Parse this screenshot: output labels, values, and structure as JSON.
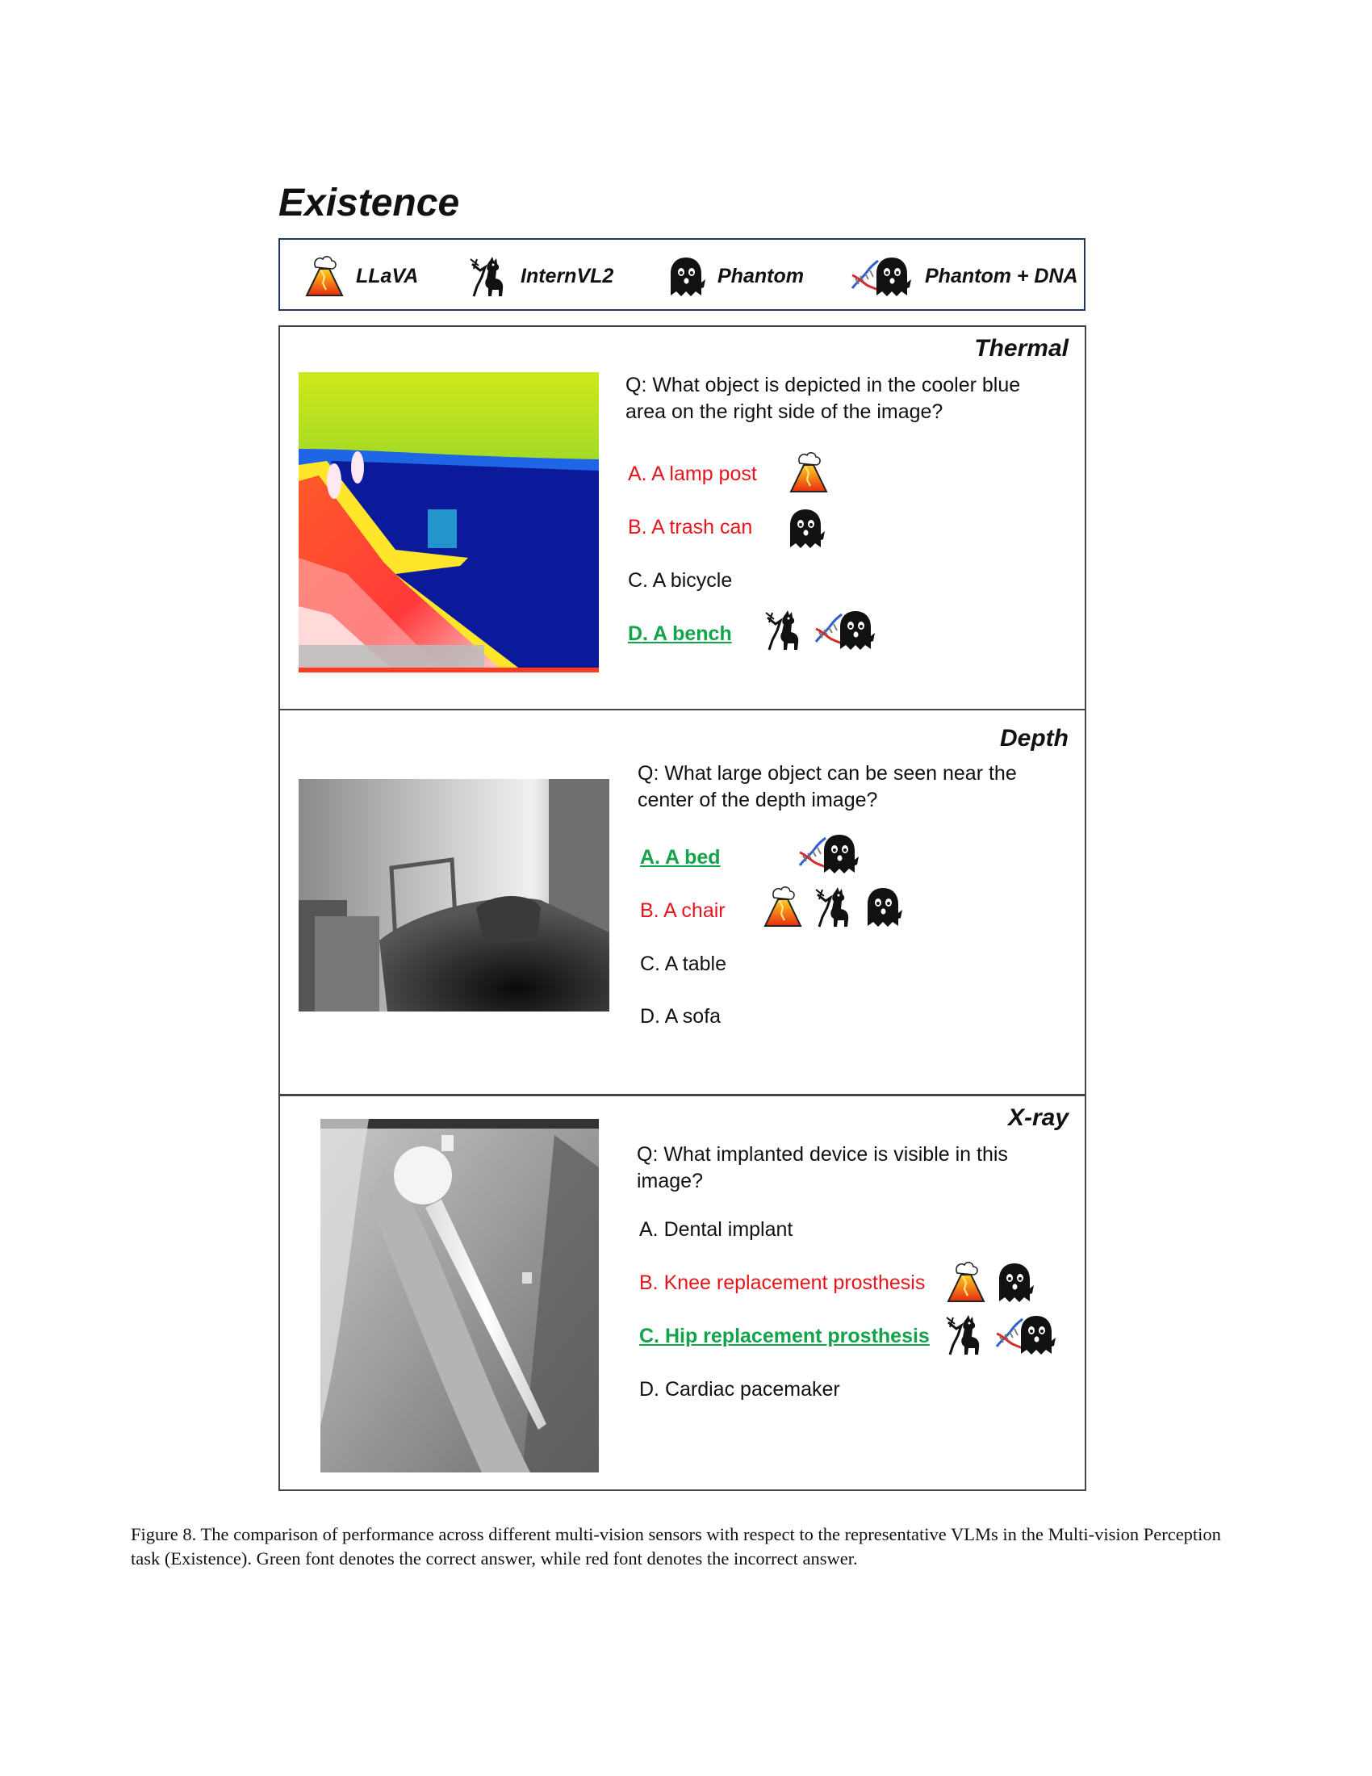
{
  "heading": "Existence",
  "legend": [
    {
      "label": "LLaVA",
      "icon": "llava-volcano-icon"
    },
    {
      "label": "InternVL2",
      "icon": "internvl2-llama-icon"
    },
    {
      "label": "Phantom",
      "icon": "phantom-ghost-icon"
    },
    {
      "label": "Phantom + DNA",
      "icon": "phantom-dna-icon"
    }
  ],
  "panels": [
    {
      "sensor": "Thermal",
      "question": "Q: What object is depicted in the cooler blue area on the right side of the image?",
      "options": [
        {
          "text": "A. A lamp post",
          "status": "incorrect",
          "models": [
            "LLaVA"
          ]
        },
        {
          "text": "B. A trash can",
          "status": "incorrect",
          "models": [
            "Phantom"
          ]
        },
        {
          "text": "C. A bicycle",
          "status": "neutral",
          "models": []
        },
        {
          "text": "D. A bench",
          "status": "correct",
          "models": [
            "InternVL2",
            "Phantom + DNA"
          ]
        }
      ]
    },
    {
      "sensor": "Depth",
      "question": "Q: What large object can be seen near the center of the depth image?",
      "options": [
        {
          "text": "A. A bed",
          "status": "correct",
          "models": [
            "Phantom + DNA"
          ]
        },
        {
          "text": "B. A chair",
          "status": "incorrect",
          "models": [
            "LLaVA",
            "InternVL2",
            "Phantom"
          ]
        },
        {
          "text": "C. A table",
          "status": "neutral",
          "models": []
        },
        {
          "text": "D. A sofa",
          "status": "neutral",
          "models": []
        }
      ]
    },
    {
      "sensor": "X-ray",
      "question": "Q: What implanted device is visible in this image?",
      "options": [
        {
          "text": "A. Dental implant",
          "status": "neutral",
          "models": []
        },
        {
          "text": "B. Knee replacement prosthesis",
          "status": "incorrect",
          "models": [
            "LLaVA",
            "Phantom"
          ]
        },
        {
          "text": "C. Hip replacement prosthesis",
          "status": "correct",
          "models": [
            "InternVL2",
            "Phantom + DNA"
          ]
        },
        {
          "text": "D. Cardiac pacemaker",
          "status": "neutral",
          "models": []
        }
      ]
    }
  ],
  "caption": "Figure 8. The comparison of performance across different multi-vision sensors with respect to the representative VLMs in the Multi-vision Perception task (Existence). Green font denotes the correct answer, while red font denotes the incorrect answer.",
  "colors": {
    "correct": "#13a34b",
    "incorrect": "#e8141b",
    "legend_border": "#1f3864"
  }
}
